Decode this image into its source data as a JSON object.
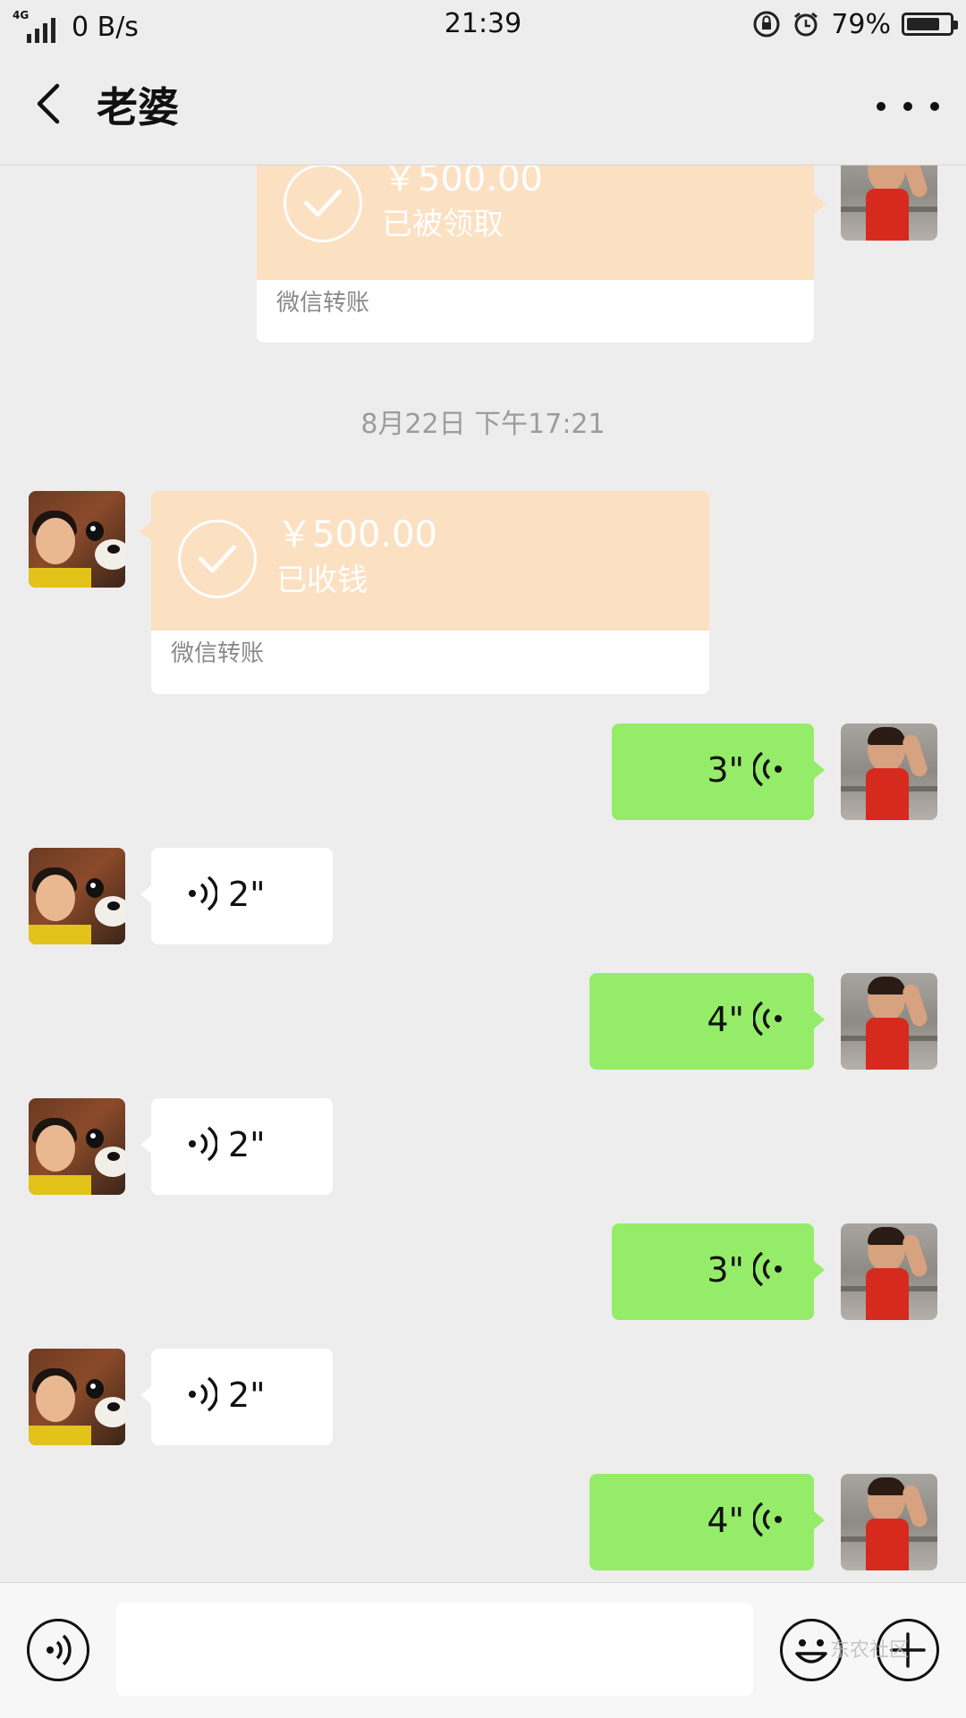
{
  "status_bar": {
    "network_type": "4G",
    "net_speed": "0 B/s",
    "time": "21:39",
    "battery_percent": "79%",
    "battery_level": 0.79
  },
  "header": {
    "title": "老婆",
    "back_icon": "back-chevron-icon",
    "more_icon": "more-dots-icon"
  },
  "chat": {
    "transfer_sent": {
      "amount": "￥500.00",
      "status": "已被领取",
      "label": "微信转账"
    },
    "timestamp": "8月22日 下午17:21",
    "transfer_received": {
      "amount": "￥500.00",
      "status": "已收钱",
      "label": "微信转账"
    },
    "voice_messages": [
      {
        "from": "me",
        "duration": "3\""
      },
      {
        "from": "wife",
        "duration": "2\""
      },
      {
        "from": "me",
        "duration": "4\""
      },
      {
        "from": "wife",
        "duration": "2\""
      },
      {
        "from": "me",
        "duration": "3\""
      },
      {
        "from": "wife",
        "duration": "2\""
      },
      {
        "from": "me",
        "duration": "4\""
      }
    ]
  },
  "input_bar": {
    "voice_icon": "voice-mode-icon",
    "emoji_icon": "emoji-icon",
    "plus_icon": "plus-icon",
    "text_value": "",
    "watermark": "东农社区"
  },
  "colors": {
    "background": "#ededed",
    "sent_bubble": "#95ec69",
    "received_bubble": "#ffffff",
    "transfer_bubble": "#fce0c2"
  }
}
